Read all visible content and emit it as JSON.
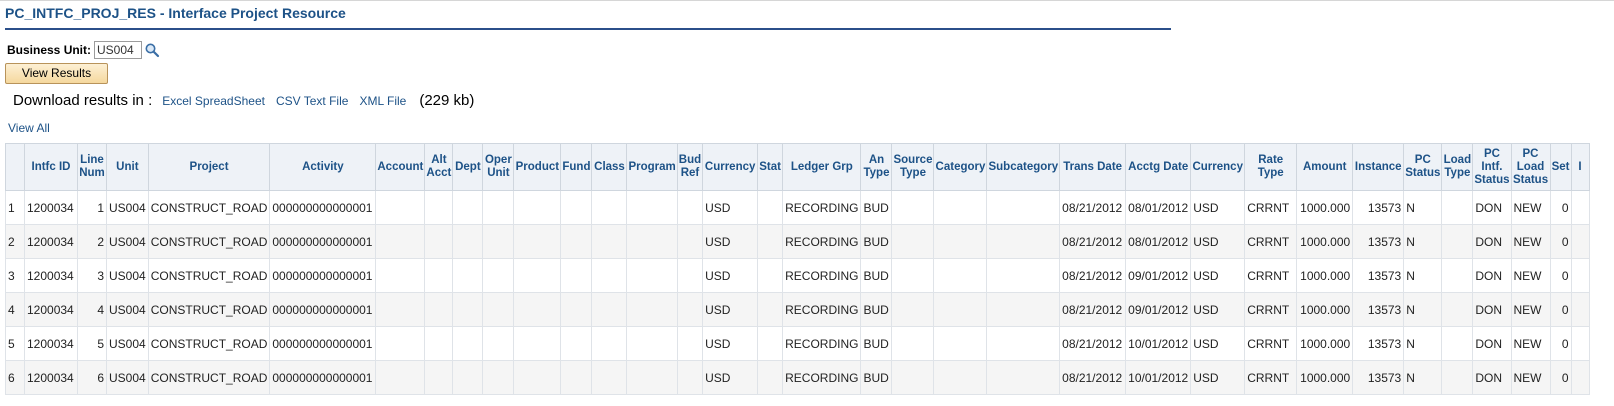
{
  "page": {
    "title": "PC_INTFC_PROJ_RES - Interface Project Resource"
  },
  "prompt": {
    "business_unit_label": "Business Unit:",
    "business_unit_value": "US004",
    "view_results_label": "View Results"
  },
  "download": {
    "label": "Download results in :",
    "excel_label": "Excel SpreadSheet",
    "csv_label": "CSV Text File",
    "xml_label": "XML File",
    "size": "(229 kb)"
  },
  "view_all_label": "View All",
  "grid": {
    "headers": [
      "",
      "Intfc ID",
      "Line Num",
      "Unit",
      "Project",
      "Activity",
      "Account",
      "Alt Acct",
      "Dept",
      "Oper Unit",
      "Product",
      "Fund",
      "Class",
      "Program",
      "Bud Ref",
      "Currency",
      "Stat",
      "Ledger Grp",
      "An Type",
      "Source Type",
      "Category",
      "Subcategory",
      "Trans Date",
      "Acctg Date",
      "Currency",
      "Rate Type",
      "Amount",
      "Instance",
      "PC Status",
      "Load Type",
      "PC Intf. Status",
      "PC Load Status",
      "Set",
      "I"
    ],
    "rows": [
      [
        "1",
        "1200034",
        "1",
        "US004",
        "CONSTRUCT_ROAD",
        "000000000000001",
        "",
        "",
        "",
        "",
        "",
        "",
        "",
        "",
        "",
        "USD",
        "",
        "RECORDING",
        "BUD",
        "",
        "",
        "",
        "08/21/2012",
        "08/01/2012",
        "USD",
        "CRRNT",
        "1000.000",
        "13573",
        "N",
        "",
        "DON",
        "NEW",
        "0",
        ""
      ],
      [
        "2",
        "1200034",
        "2",
        "US004",
        "CONSTRUCT_ROAD",
        "000000000000001",
        "",
        "",
        "",
        "",
        "",
        "",
        "",
        "",
        "",
        "USD",
        "",
        "RECORDING",
        "BUD",
        "",
        "",
        "",
        "08/21/2012",
        "08/01/2012",
        "USD",
        "CRRNT",
        "1000.000",
        "13573",
        "N",
        "",
        "DON",
        "NEW",
        "0",
        ""
      ],
      [
        "3",
        "1200034",
        "3",
        "US004",
        "CONSTRUCT_ROAD",
        "000000000000001",
        "",
        "",
        "",
        "",
        "",
        "",
        "",
        "",
        "",
        "USD",
        "",
        "RECORDING",
        "BUD",
        "",
        "",
        "",
        "08/21/2012",
        "09/01/2012",
        "USD",
        "CRRNT",
        "1000.000",
        "13573",
        "N",
        "",
        "DON",
        "NEW",
        "0",
        ""
      ],
      [
        "4",
        "1200034",
        "4",
        "US004",
        "CONSTRUCT_ROAD",
        "000000000000001",
        "",
        "",
        "",
        "",
        "",
        "",
        "",
        "",
        "",
        "USD",
        "",
        "RECORDING",
        "BUD",
        "",
        "",
        "",
        "08/21/2012",
        "09/01/2012",
        "USD",
        "CRRNT",
        "1000.000",
        "13573",
        "N",
        "",
        "DON",
        "NEW",
        "0",
        ""
      ],
      [
        "5",
        "1200034",
        "5",
        "US004",
        "CONSTRUCT_ROAD",
        "000000000000001",
        "",
        "",
        "",
        "",
        "",
        "",
        "",
        "",
        "",
        "USD",
        "",
        "RECORDING",
        "BUD",
        "",
        "",
        "",
        "08/21/2012",
        "10/01/2012",
        "USD",
        "CRRNT",
        "1000.000",
        "13573",
        "N",
        "",
        "DON",
        "NEW",
        "0",
        ""
      ],
      [
        "6",
        "1200034",
        "6",
        "US004",
        "CONSTRUCT_ROAD",
        "000000000000001",
        "",
        "",
        "",
        "",
        "",
        "",
        "",
        "",
        "",
        "USD",
        "",
        "RECORDING",
        "BUD",
        "",
        "",
        "",
        "08/21/2012",
        "10/01/2012",
        "USD",
        "CRRNT",
        "1000.000",
        "13573",
        "N",
        "",
        "DON",
        "NEW",
        "0",
        ""
      ]
    ]
  },
  "colors": {
    "title": "#1d5287",
    "header_bg": "#eef2f7",
    "button_bg": "#f5d89e"
  }
}
